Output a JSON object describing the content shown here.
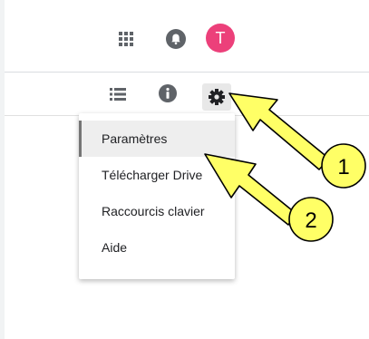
{
  "header": {
    "apps_icon": "apps-grid-icon",
    "notifications_icon": "bell-icon",
    "avatar_letter": "T",
    "avatar_color": "#ec407a"
  },
  "toolbar": {
    "list_view_icon": "list-view-icon",
    "info_icon": "info-icon",
    "settings_icon": "gear-icon"
  },
  "menu": {
    "items": [
      {
        "label": "Paramètres",
        "active": true
      },
      {
        "label": "Télécharger Drive",
        "active": false
      },
      {
        "label": "Raccourcis clavier",
        "active": false
      },
      {
        "label": "Aide",
        "active": false
      }
    ]
  },
  "annotations": {
    "callout_1": "1",
    "callout_2": "2",
    "callout_color": "#ffff66"
  }
}
